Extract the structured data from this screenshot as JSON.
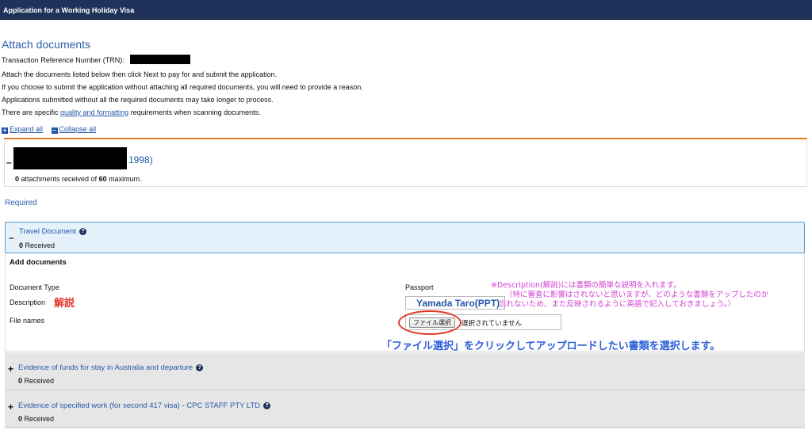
{
  "app": {
    "title": "Application for a Working Holiday Visa"
  },
  "page": {
    "title": "Attach documents",
    "trn_label": "Transaction Reference Number (TRN):",
    "instructions": [
      "Attach the documents listed below then click Next to pay for and submit the application.",
      "If you choose to submit the application without attaching all required documents, you will need to provide a reason.",
      "Applications submitted without all the required documents may take longer to process."
    ],
    "scan_prefix": "There are specific ",
    "scan_link": "quality and formatting",
    "scan_suffix": " requirements when scanning documents.",
    "expand_all": "Expand all",
    "collapse_all": "Collapse all"
  },
  "applicant": {
    "toggle": "–",
    "year_suffix": "1998)",
    "received": "0",
    "received_mid": " attachments received of ",
    "max": "60",
    "max_suffix": " maximum."
  },
  "required_heading": "Required",
  "sections": [
    {
      "toggle": "–",
      "title": "Travel Document",
      "received_count": "0",
      "received_label": " Received"
    },
    {
      "toggle": "+",
      "title": "Evidence of funds for stay in Australia and departure",
      "received_count": "0",
      "received_label": " Received"
    },
    {
      "toggle": "+",
      "title": "Evidence of specified work (for second 417 visa) - CPC STAFF PTY LTD",
      "received_count": "0",
      "received_label": " Received"
    }
  ],
  "add_documents": {
    "heading": "Add documents",
    "document_type_label": "Document Type",
    "document_type_value": "Passport",
    "description_label": "Description",
    "description_value": "Yamada Taro(PPT)",
    "file_names_label": "File names",
    "choose_file_button": "ファイル選択",
    "no_file_selected": "選択されていません"
  },
  "annotations": {
    "description_note": "解説",
    "pink_lines": [
      "※Description(解説)には書類の簡単な説明を入れます。",
      "（特に審査に影響はされないと思いますが、どのような書類をアップしたのか",
      "忘れないため、また反映されるように英語で記入しておきましょう。）"
    ],
    "blue_instruction": "「ファイル選択」をクリックしてアップロードしたい書類を選択します。"
  },
  "colors": {
    "header_bg": "#1f3259",
    "link": "#2457a8",
    "accent_orange": "#e07b2a",
    "annotation_red": "#e2382a",
    "annotation_pink": "#d33fd3",
    "annotation_blue": "#2f5fd8"
  }
}
